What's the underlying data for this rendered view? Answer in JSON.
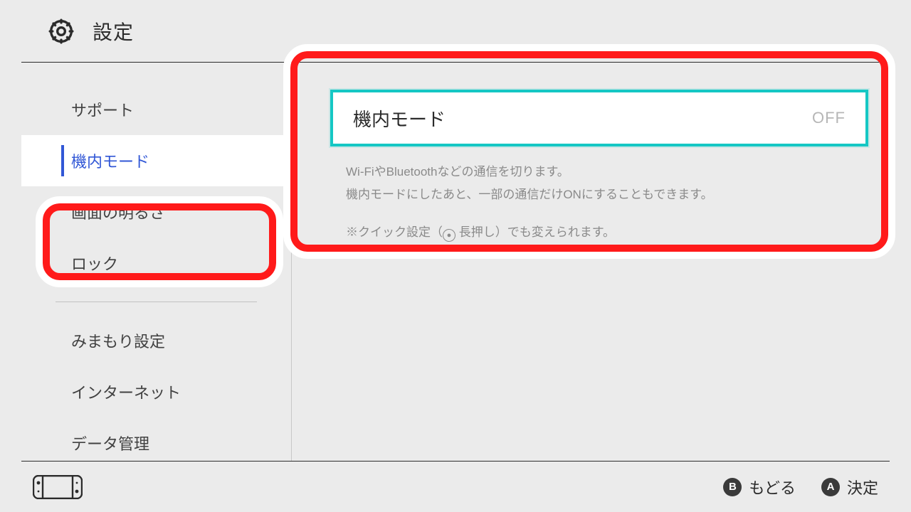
{
  "header": {
    "title": "設定"
  },
  "sidebar": {
    "items": [
      {
        "label": "サポート",
        "selected": false
      },
      {
        "label": "機内モード",
        "selected": true
      },
      {
        "label": "画面の明るさ",
        "selected": false
      },
      {
        "label": "ロック",
        "selected": false
      },
      {
        "label": "みまもり設定",
        "selected": false
      },
      {
        "label": "インターネット",
        "selected": false
      },
      {
        "label": "データ管理",
        "selected": false
      }
    ]
  },
  "main": {
    "toggle": {
      "label": "機内モード",
      "value": "OFF"
    },
    "desc_line1": "Wi-FiやBluetoothなどの通信を切ります。",
    "desc_line2": "機内モードにしたあと、一部の通信だけONにすることもできます。",
    "note_prefix": "※クイック設定（",
    "note_button_glyph": "⊙",
    "note_mid": " 長押し）でも変えられます。"
  },
  "footer": {
    "b_glyph": "B",
    "b_label": "もどる",
    "a_glyph": "A",
    "a_label": "決定"
  }
}
